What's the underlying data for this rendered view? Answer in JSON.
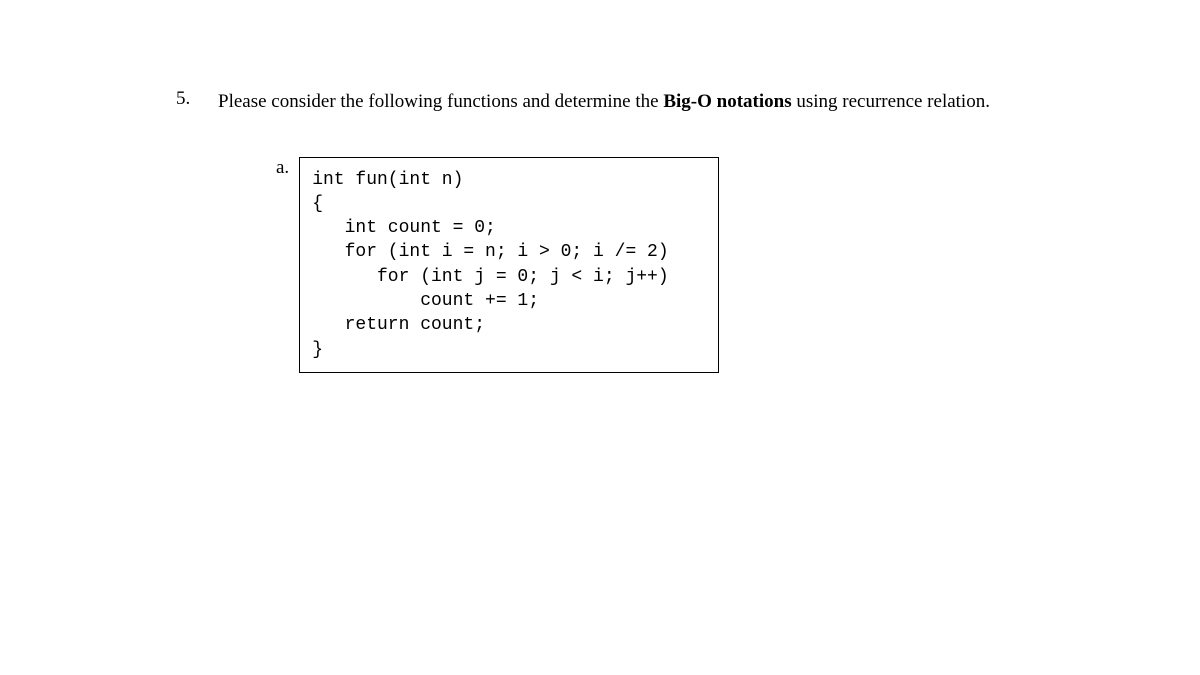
{
  "question": {
    "number": "5.",
    "text_parts": [
      "Please consider the following functions and determine the ",
      "Big-O notations",
      " using recurrence relation."
    ]
  },
  "subitem": {
    "label": "a.",
    "code": "int fun(int n)\n{\n   int count = 0;\n   for (int i = n; i > 0; i /= 2)\n      for (int j = 0; j < i; j++)\n          count += 1;\n   return count;\n}"
  }
}
